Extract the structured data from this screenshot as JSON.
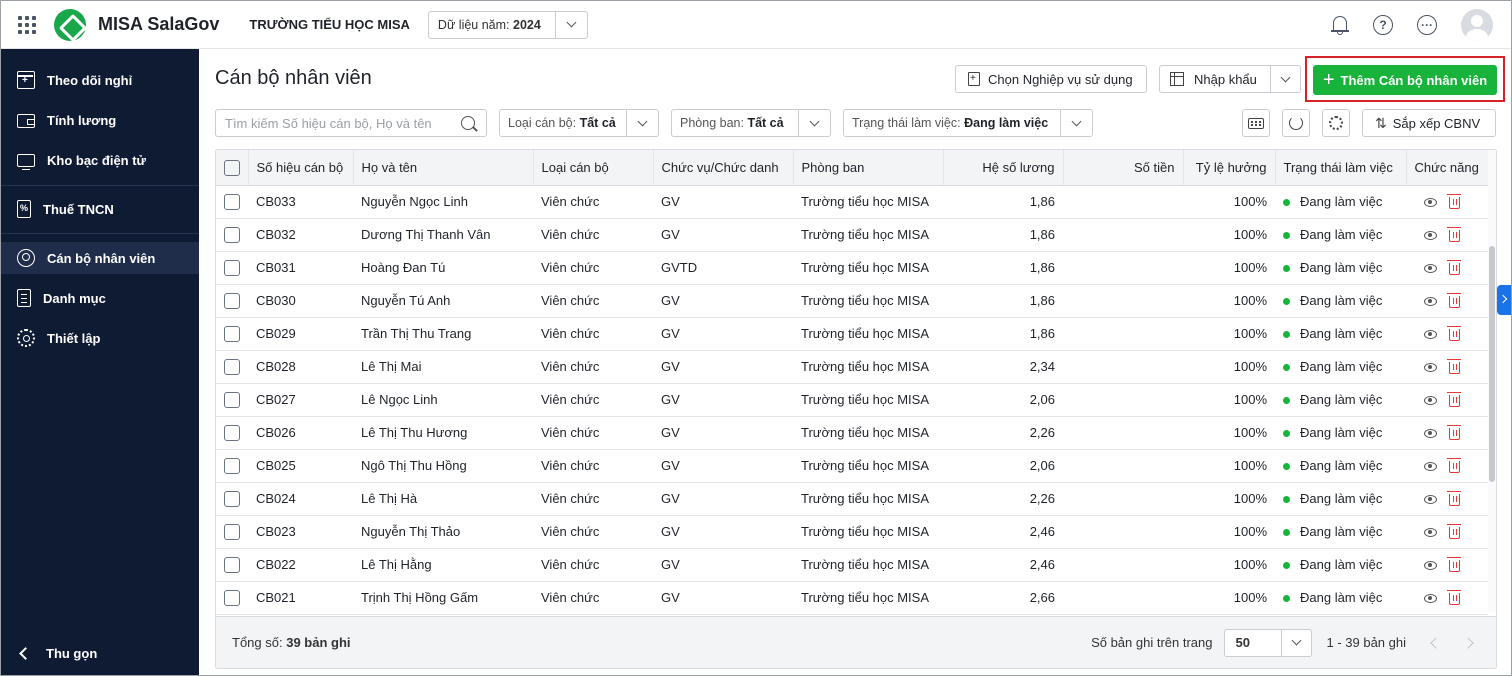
{
  "topbar": {
    "app_name": "MISA SalaGov",
    "school": "TRƯỜNG TIỂU HỌC MISA",
    "year_label": "Dữ liệu năm:",
    "year_value": "2024",
    "help_icon": "?",
    "more_icon": "···"
  },
  "sidebar": {
    "items": [
      {
        "label": "Theo dõi nghỉ",
        "icon": "calendar-icon"
      },
      {
        "label": "Tính lương",
        "icon": "wallet-icon"
      },
      {
        "label": "Kho bạc điện tử",
        "icon": "monitor-icon"
      },
      {
        "label": "Thuế TNCN",
        "icon": "tax-doc-icon"
      },
      {
        "label": "Cán bộ nhân viên",
        "icon": "people-icon"
      },
      {
        "label": "Danh mục",
        "icon": "list-icon"
      },
      {
        "label": "Thiết lập",
        "icon": "gear-icon"
      }
    ],
    "collapse_label": "Thu gọn"
  },
  "main": {
    "title": "Cán bộ nhân viên",
    "choose_btn": "Chọn Nghiệp vụ sử dụng",
    "import_btn": "Nhập khẩu",
    "add_btn": "Thêm Cán bộ nhân viên",
    "search_placeholder": "Tìm kiếm Số hiệu cán bộ, Họ và tên",
    "filter_type_label": "Loại cán bộ:",
    "filter_type_value": "Tất cả",
    "filter_dept_label": "Phòng ban:",
    "filter_dept_value": "Tất cả",
    "filter_status_label": "Trạng thái làm việc:",
    "filter_status_value": "Đang làm việc",
    "sort_btn": "Sắp xếp CBNV"
  },
  "table": {
    "headers": [
      "Số hiệu cán bộ",
      "Họ và tên",
      "Loại cán bộ",
      "Chức vụ/Chức danh",
      "Phòng ban",
      "Hệ số lương",
      "Số tiền",
      "Tỷ lệ hưởng",
      "Trạng thái làm việc",
      "Chức năng"
    ],
    "rows": [
      {
        "code": "CB033",
        "name": "Nguyễn Ngọc Linh",
        "type": "Viên chức",
        "position": "GV",
        "dept": "Trường tiểu học MISA",
        "coef": "1,86",
        "amount": "",
        "rate": "100%",
        "status": "Đang làm việc"
      },
      {
        "code": "CB032",
        "name": "Dương Thị Thanh Vân",
        "type": "Viên chức",
        "position": "GV",
        "dept": "Trường tiểu học MISA",
        "coef": "1,86",
        "amount": "",
        "rate": "100%",
        "status": "Đang làm việc"
      },
      {
        "code": "CB031",
        "name": "Hoàng Đan Tú",
        "type": "Viên chức",
        "position": "GVTD",
        "dept": "Trường tiểu học MISA",
        "coef": "1,86",
        "amount": "",
        "rate": "100%",
        "status": "Đang làm việc"
      },
      {
        "code": "CB030",
        "name": "Nguyễn Tú Anh",
        "type": "Viên chức",
        "position": "GV",
        "dept": "Trường tiểu học MISA",
        "coef": "1,86",
        "amount": "",
        "rate": "100%",
        "status": "Đang làm việc"
      },
      {
        "code": "CB029",
        "name": "Trần Thị Thu Trang",
        "type": "Viên chức",
        "position": "GV",
        "dept": "Trường tiểu học MISA",
        "coef": "1,86",
        "amount": "",
        "rate": "100%",
        "status": "Đang làm việc"
      },
      {
        "code": "CB028",
        "name": "Lê Thị Mai",
        "type": "Viên chức",
        "position": "GV",
        "dept": "Trường tiểu học MISA",
        "coef": "2,34",
        "amount": "",
        "rate": "100%",
        "status": "Đang làm việc"
      },
      {
        "code": "CB027",
        "name": "Lê Ngọc Linh",
        "type": "Viên chức",
        "position": "GV",
        "dept": "Trường tiểu học MISA",
        "coef": "2,06",
        "amount": "",
        "rate": "100%",
        "status": "Đang làm việc"
      },
      {
        "code": "CB026",
        "name": "Lê Thị Thu Hương",
        "type": "Viên chức",
        "position": "GV",
        "dept": "Trường tiểu học MISA",
        "coef": "2,26",
        "amount": "",
        "rate": "100%",
        "status": "Đang làm việc"
      },
      {
        "code": "CB025",
        "name": "Ngô Thị Thu Hồng",
        "type": "Viên chức",
        "position": "GV",
        "dept": "Trường tiểu học MISA",
        "coef": "2,06",
        "amount": "",
        "rate": "100%",
        "status": "Đang làm việc"
      },
      {
        "code": "CB024",
        "name": "Lê Thị Hà",
        "type": "Viên chức",
        "position": "GV",
        "dept": "Trường tiểu học MISA",
        "coef": "2,26",
        "amount": "",
        "rate": "100%",
        "status": "Đang làm việc"
      },
      {
        "code": "CB023",
        "name": "Nguyễn Thị Thảo",
        "type": "Viên chức",
        "position": "GV",
        "dept": "Trường tiểu học MISA",
        "coef": "2,46",
        "amount": "",
        "rate": "100%",
        "status": "Đang làm việc"
      },
      {
        "code": "CB022",
        "name": "Lê Thị Hằng",
        "type": "Viên chức",
        "position": "GV",
        "dept": "Trường tiểu học MISA",
        "coef": "2,46",
        "amount": "",
        "rate": "100%",
        "status": "Đang làm việc"
      },
      {
        "code": "CB021",
        "name": "Trịnh Thị Hồng Gấm",
        "type": "Viên chức",
        "position": "GV",
        "dept": "Trường tiểu học MISA",
        "coef": "2,66",
        "amount": "",
        "rate": "100%",
        "status": "Đang làm việc"
      }
    ]
  },
  "footer": {
    "total_label": "Tổng số:",
    "total_value": "39 bản ghi",
    "per_page_label": "Số bản ghi trên trang",
    "per_page_value": "50",
    "range": "1 - 39 bản ghi"
  },
  "colors": {
    "sidebar_bg": "#0f1b33",
    "primary_green": "#17b33a",
    "highlight_red": "#d92027",
    "delete_red": "#e53935"
  }
}
